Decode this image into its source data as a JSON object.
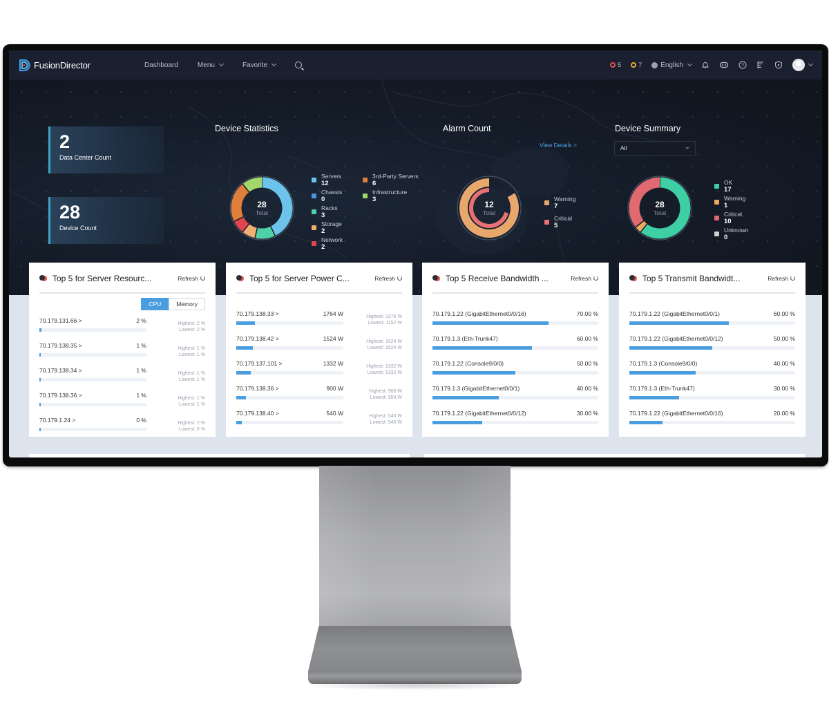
{
  "app": {
    "name": "FusionDirector",
    "nav": [
      {
        "label": "Dashboard",
        "has_dropdown": false
      },
      {
        "label": "Menu",
        "has_dropdown": true
      },
      {
        "label": "Favorite",
        "has_dropdown": true
      }
    ],
    "alarms": {
      "critical": {
        "count": "5",
        "color": "#e0524f"
      },
      "major": {
        "count": "7",
        "color": "#e8a838"
      }
    },
    "language": "English",
    "tool_icons": [
      "bell-icon",
      "robot-icon",
      "help-icon",
      "task-list-icon",
      "shield-icon"
    ]
  },
  "hero": {
    "stats": [
      {
        "value": "2",
        "label": "Data Center Count"
      },
      {
        "value": "28",
        "label": "Device Count"
      }
    ],
    "device_statistics": {
      "title": "Device Statistics",
      "total": "28",
      "total_label": "Total",
      "legend": [
        {
          "label": "Servers",
          "value": "12",
          "color": "#6cc3ec"
        },
        {
          "label": "Chassis",
          "value": "0",
          "color": "#4f8fe0"
        },
        {
          "label": "Racks",
          "value": "3",
          "color": "#4fd1a7"
        },
        {
          "label": "Storage",
          "value": "2",
          "color": "#f0b070"
        },
        {
          "label": "Network",
          "value": "2",
          "color": "#e0454f"
        },
        {
          "label": "3rd-Party Servers",
          "value": "6",
          "color": "#e07e3c"
        },
        {
          "label": "Infrastructure",
          "value": "3",
          "color": "#a2d86a"
        }
      ]
    },
    "alarm_count": {
      "title": "Alarm Count",
      "view_details": "View Details >",
      "total": "12",
      "total_label": "Total",
      "legend": [
        {
          "label": "Warning",
          "value": "7",
          "color": "#e8a86c"
        },
        {
          "label": "Critical",
          "value": "5",
          "color": "#e87074"
        }
      ]
    },
    "device_summary": {
      "title": "Device Summary",
      "filter_value": "All",
      "total": "28",
      "total_label": "Total",
      "legend": [
        {
          "label": "OK",
          "value": "17",
          "color": "#3ed0a4"
        },
        {
          "label": "Warning",
          "value": "1",
          "color": "#f0a860"
        },
        {
          "label": "Critical",
          "value": "10",
          "color": "#e06a70"
        },
        {
          "label": "Unknown",
          "value": "0",
          "color": "#d0d0d0"
        }
      ]
    }
  },
  "cards": [
    {
      "title": "Top 5 for Server Resourc...",
      "refresh": "Refresh",
      "toggle": [
        "CPU",
        "Memory"
      ],
      "active_toggle": 0,
      "rows": [
        {
          "name": "70.179.131.66 >",
          "value": "2 %",
          "fraction": 0.02,
          "highest": "Highest: 2 %",
          "lowest": "Lowest: 2 %"
        },
        {
          "name": "70.179.138.35 >",
          "value": "1 %",
          "fraction": 0.01,
          "highest": "Highest: 1 %",
          "lowest": "Lowest: 1 %"
        },
        {
          "name": "70.179.138.34 >",
          "value": "1 %",
          "fraction": 0.01,
          "highest": "Highest: 1 %",
          "lowest": "Lowest: 1 %"
        },
        {
          "name": "70.179.138.36 >",
          "value": "1 %",
          "fraction": 0.01,
          "highest": "Highest: 1 %",
          "lowest": "Lowest: 1 %"
        },
        {
          "name": "70.179.1.24 >",
          "value": "0 %",
          "fraction": 0.005,
          "highest": "Highest: 2 %",
          "lowest": "Lowest: 0 %"
        }
      ]
    },
    {
      "title": "Top 5 for Server Power C...",
      "refresh": "Refresh",
      "rows": [
        {
          "name": "70.179.138.33 >",
          "value": "1764 W",
          "fraction": 0.176,
          "highest": "Highest: 2376 W",
          "lowest": "Lowest: 1152 W"
        },
        {
          "name": "70.179.138.42 >",
          "value": "1524 W",
          "fraction": 0.152,
          "highest": "Highest: 1524 W",
          "lowest": "Lowest: 1524 W"
        },
        {
          "name": "70.179.137.101 >",
          "value": "1332 W",
          "fraction": 0.133,
          "highest": "Highest: 1332 W",
          "lowest": "Lowest: 1332 W"
        },
        {
          "name": "70.179.138.36 >",
          "value": "900 W",
          "fraction": 0.09,
          "highest": "Highest: 900 W",
          "lowest": "Lowest: 900 W"
        },
        {
          "name": "70.179.138.40 >",
          "value": "540 W",
          "fraction": 0.054,
          "highest": "Highest: 540 W",
          "lowest": "Lowest: 540 W"
        }
      ]
    },
    {
      "title": "Top 5 Receive Bandwidth ...",
      "refresh": "Refresh",
      "rows": [
        {
          "name": "70.179.1.22 (GigabitEthernet0/0/16)",
          "value": "70.00 %",
          "fraction": 0.7
        },
        {
          "name": "70.179.1.3 (Eth-Trunk47)",
          "value": "60.00 %",
          "fraction": 0.6
        },
        {
          "name": "70.179.1.22 (Console9/0/0)",
          "value": "50.00 %",
          "fraction": 0.5
        },
        {
          "name": "70.179.1.3 (GigabitEthernet0/0/1)",
          "value": "40.00 %",
          "fraction": 0.4
        },
        {
          "name": "70.179.1.22 (GigabitEthernet0/0/12)",
          "value": "30.00 %",
          "fraction": 0.3
        }
      ]
    },
    {
      "title": "Top 5 Transmit Bandwidt...",
      "refresh": "Refresh",
      "rows": [
        {
          "name": "70.179.1.22 (GigabitEthernet0/0/1)",
          "value": "60.00 %",
          "fraction": 0.6
        },
        {
          "name": "70.179.1.22 (GigabitEthernet0/0/12)",
          "value": "50.00 %",
          "fraction": 0.5
        },
        {
          "name": "70.179.1.3 (Console9/0/0)",
          "value": "40.00 %",
          "fraction": 0.4
        },
        {
          "name": "70.179.1.3 (Eth-Trunk47)",
          "value": "30.00 %",
          "fraction": 0.3
        },
        {
          "name": "70.179.1.22 (GigabitEthernet0/0/16)",
          "value": "20.00 %",
          "fraction": 0.2
        }
      ]
    }
  ]
}
